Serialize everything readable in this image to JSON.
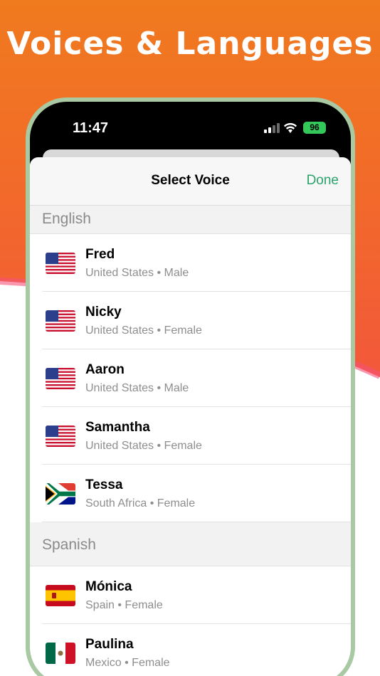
{
  "headline": "Voices & Languages",
  "status_bar": {
    "time": "11:47",
    "battery": "96"
  },
  "sheet": {
    "title": "Select Voice",
    "done_label": "Done"
  },
  "sections": [
    {
      "title": "English",
      "voices": [
        {
          "name": "Fred",
          "detail": "United States • Male",
          "flag": "us-flag-icon"
        },
        {
          "name": "Nicky",
          "detail": "United States • Female",
          "flag": "us-flag-icon"
        },
        {
          "name": "Aaron",
          "detail": "United States • Male",
          "flag": "us-flag-icon"
        },
        {
          "name": "Samantha",
          "detail": "United States • Female",
          "flag": "us-flag-icon"
        },
        {
          "name": "Tessa",
          "detail": "South Africa • Female",
          "flag": "south-africa-flag-icon"
        }
      ]
    },
    {
      "title": "Spanish",
      "voices": [
        {
          "name": "Mónica",
          "detail": "Spain • Female",
          "flag": "spain-flag-icon"
        },
        {
          "name": "Paulina",
          "detail": "Mexico • Female",
          "flag": "mexico-flag-icon"
        }
      ]
    }
  ],
  "colors": {
    "accent": "#2aa36b",
    "phone_frame": "#a9c9a2",
    "background_top": "#f07a1e"
  }
}
